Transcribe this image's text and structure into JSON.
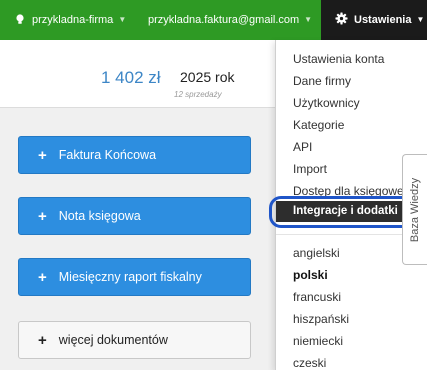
{
  "topbar": {
    "account": {
      "label": "przykladna-firma",
      "icon": "lightbulb-icon"
    },
    "email": {
      "label": "przykladna.faktura@gmail.com"
    },
    "settings": {
      "label": "Ustawienia",
      "icon": "gear-icon"
    }
  },
  "stats": {
    "amount": "1 402 zł",
    "year": "2025 rok",
    "count": "12 sprzedaży"
  },
  "documents": {
    "final_invoice": "Faktura Końcowa",
    "accounting_note": "Nota księgowa",
    "monthly_report": "Miesięczny raport fiskalny",
    "more": "więcej dokumentów"
  },
  "menu": {
    "account_settings": "Ustawienia konta",
    "company_data": "Dane firmy",
    "users": "Użytkownicy",
    "categories": "Kategorie",
    "api": "API",
    "import": "Import",
    "accountant_access": "Dostęp dla księgowej",
    "integrations": "Integracje i dodatki",
    "languages": [
      "angielski",
      "polski",
      "francuski",
      "hiszpański",
      "niemiecki",
      "czeski"
    ],
    "active_language": "polski"
  },
  "knowledge_base": {
    "label": "Baza Wiedzy"
  },
  "colors": {
    "topbar": "#2e9a24",
    "settings_bg": "#1b1b1b",
    "primary_button": "#2d8ee0",
    "amount": "#3d86c6",
    "highlight": "#1f55c8"
  }
}
